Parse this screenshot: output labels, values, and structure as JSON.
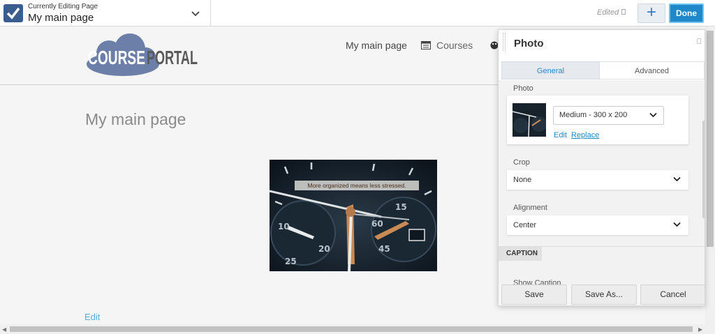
{
  "topbar": {
    "editing_label": "Currently Editing Page",
    "editing_page": "My main page",
    "edited_status": "Edited",
    "add_button": "+",
    "done_button": "Done"
  },
  "site": {
    "logo_word1": "COURSE",
    "logo_word2": "PORTAL",
    "nav": [
      {
        "label": "My main page"
      },
      {
        "label": "Courses",
        "icon": "list-icon"
      }
    ],
    "extra_nav_icon": "palette-icon"
  },
  "content": {
    "heading": "My main page",
    "photo_caption": "More organized means less stressed.",
    "edit_link": "Edit"
  },
  "panel": {
    "title": "Photo",
    "tabs": [
      {
        "label": "General",
        "active": true
      },
      {
        "label": "Advanced",
        "active": false
      }
    ],
    "photo_label": "Photo",
    "photo_size": "Medium - 300 x 200",
    "photo_edit_link": "Edit",
    "photo_replace_link": "Replace",
    "crop_label": "Crop",
    "crop_value": "None",
    "alignment_label": "Alignment",
    "alignment_value": "Center",
    "caption_section": "CAPTION",
    "show_caption_label": "Show Caption",
    "buttons": {
      "save": "Save",
      "save_as": "Save As...",
      "cancel": "Cancel"
    }
  },
  "colors": {
    "accent": "#1e88c9",
    "logo_cloud": "#6b7fa8",
    "logo_text": "#5a5a5a"
  }
}
